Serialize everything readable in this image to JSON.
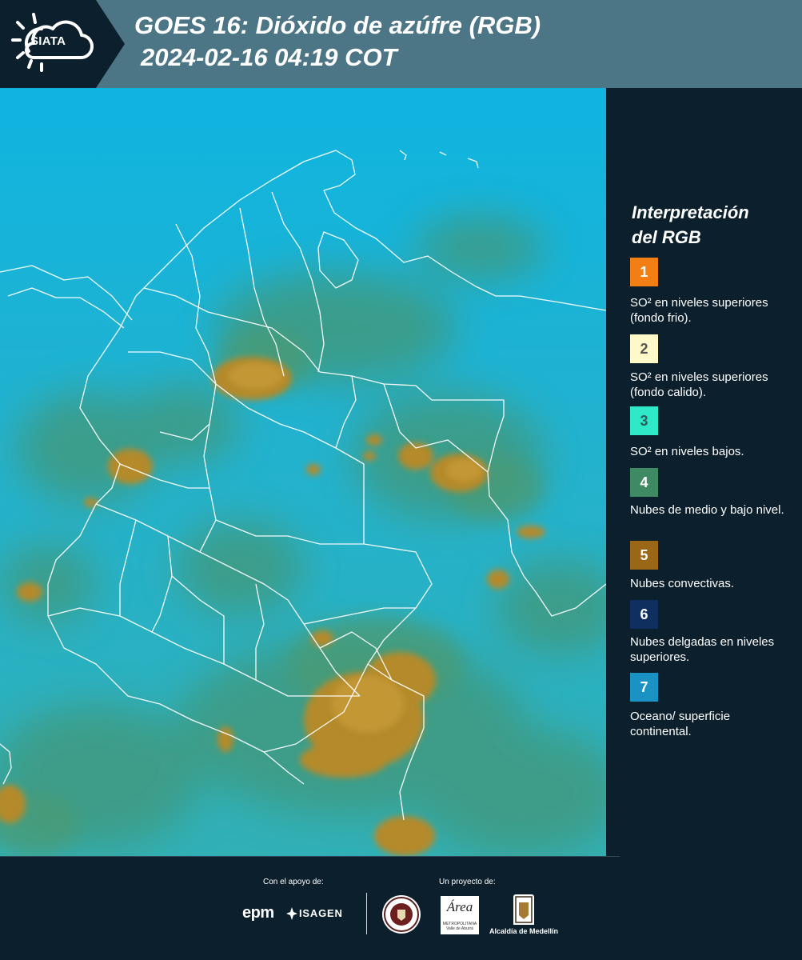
{
  "header": {
    "logo_text": "SIATA",
    "title_line1": "GOES 16: Dióxido de azúfre (RGB)",
    "title_line2": "2024-02-16 04:19 COT"
  },
  "map": {
    "description_colors": {
      "ocean": "#1ab0d2",
      "low_cloud": "#3f9a85",
      "convective": "#b28a2c",
      "border": "#ffffff"
    }
  },
  "legend": {
    "title_line1": "Interpretación",
    "title_line2": "del RGB",
    "items": [
      {
        "number": "1",
        "color": "#f37e13",
        "number_color": "#ffffff",
        "text": "SO² en niveles superiores (fondo frio)."
      },
      {
        "number": "2",
        "color": "#fff8c8",
        "number_color": "#555555",
        "text": "SO² en niveles superiores (fondo calido)."
      },
      {
        "number": "3",
        "color": "#2fe8c8",
        "number_color": "#2a5d5a",
        "text": "SO² en niveles bajos."
      },
      {
        "number": "4",
        "color": "#3d8a63",
        "number_color": "#ffffff",
        "text": "Nubes de medio y bajo nivel."
      },
      {
        "number": "5",
        "color": "#9a6716",
        "number_color": "#ffffff",
        "text": "Nubes convectivas."
      },
      {
        "number": "6",
        "color": "#0f2f5e",
        "number_color": "#ffffff",
        "text": "Nubes delgadas en niveles superiores."
      },
      {
        "number": "7",
        "color": "#1a92c4",
        "number_color": "#ffffff",
        "text": "Oceano/ superficie continental."
      }
    ]
  },
  "footer": {
    "support_label": "Con el apoyo de:",
    "project_label": "Un proyecto de:",
    "epm": "epm",
    "isagen": "ISAGEN",
    "area_mark": "Área",
    "area_sub": "METROPOLITANA Valle de Aburrá",
    "medellin": "Alcaldía de Medellín"
  }
}
